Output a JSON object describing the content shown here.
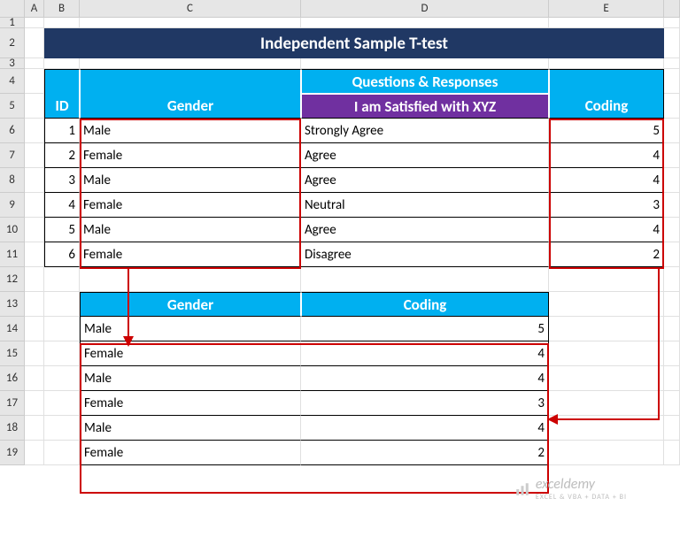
{
  "columns": [
    "A",
    "B",
    "C",
    "D",
    "E"
  ],
  "title": "Independent Sample T-test",
  "table1": {
    "headers": {
      "id": "ID",
      "gender": "Gender",
      "qr": "Questions & Responses",
      "sub": "I am Satisfied with XYZ",
      "coding": "Coding"
    },
    "rows": [
      {
        "id": "1",
        "gender": "Male",
        "resp": "Strongly Agree",
        "code": "5"
      },
      {
        "id": "2",
        "gender": "Female",
        "resp": "Agree",
        "code": "4"
      },
      {
        "id": "3",
        "gender": "Male",
        "resp": "Agree",
        "code": "4"
      },
      {
        "id": "4",
        "gender": "Female",
        "resp": "Neutral",
        "code": "3"
      },
      {
        "id": "5",
        "gender": "Male",
        "resp": "Agree",
        "code": "4"
      },
      {
        "id": "6",
        "gender": "Female",
        "resp": "Disagree",
        "code": "2"
      }
    ]
  },
  "table2": {
    "headers": {
      "gender": "Gender",
      "coding": "Coding"
    },
    "rows": [
      {
        "gender": "Male",
        "code": "5"
      },
      {
        "gender": "Female",
        "code": "4"
      },
      {
        "gender": "Male",
        "code": "4"
      },
      {
        "gender": "Female",
        "code": "3"
      },
      {
        "gender": "Male",
        "code": "4"
      },
      {
        "gender": "Female",
        "code": "2"
      }
    ]
  },
  "rownums": [
    "1",
    "2",
    "3",
    "4",
    "5",
    "6",
    "7",
    "8",
    "9",
    "10",
    "11",
    "12",
    "13",
    "14",
    "15",
    "16",
    "17",
    "18",
    "19"
  ],
  "watermark": {
    "brand": "exceldemy",
    "tag": "EXCEL & VBA + DATA + BI"
  }
}
